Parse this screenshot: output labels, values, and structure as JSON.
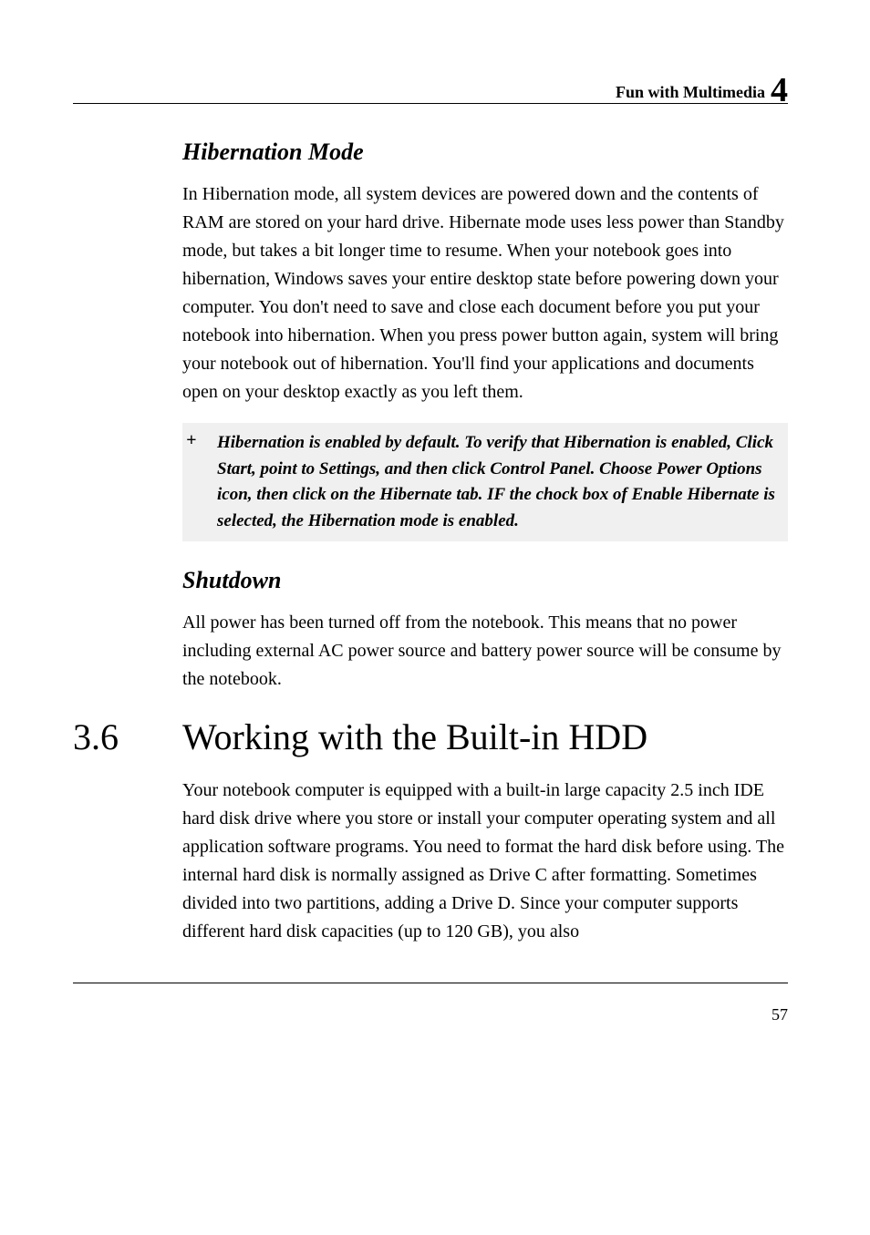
{
  "header": {
    "text": "Fun with Multimedia",
    "chapter_num": "4"
  },
  "sub1": {
    "heading": "Hibernation Mode",
    "para": "In Hibernation mode, all system devices are powered down and the contents of RAM are stored on your hard drive. Hibernate mode uses less power than Standby mode, but takes a bit longer time to resume. When your notebook goes into hibernation, Windows saves your entire desktop state before powering down your computer. You don't need to save and close each document before you put your notebook into hibernation. When you press power button again, system will bring your notebook out of hibernation. You'll find your applications and documents open on your desktop exactly as you left them."
  },
  "note": {
    "marker": "+",
    "t1": "Hibernation is enabled by default. To verify that Hibernation is enabled, Click Start, point to ",
    "b1": "Settings,",
    "t2": " and then click ",
    "b2": "Control Panel.",
    "t3": " Choose ",
    "b3": "Power Options",
    "t4": " icon, then click on the ",
    "b4": "Hibernate tab.",
    "t5": " IF the chock box of Enable Hibernate is selected, the Hibernation mode is enabled."
  },
  "sub2": {
    "heading": "Shutdown",
    "para": "All power has been turned off from the notebook. This means that no power including external AC power source and battery power source will be consume by the notebook."
  },
  "section": {
    "num": "3.6",
    "title": "Working with the Built-in HDD",
    "para": "Your notebook computer is equipped with a built-in large capacity 2.5 inch IDE hard disk drive where you store or install your computer operating system and all application software programs. You need to format the hard disk before using. The internal hard disk is normally assigned as Drive C after formatting. Sometimes divided into two partitions, adding a Drive D. Since your computer supports different hard disk capacities (up to 120 GB), you also"
  },
  "footer": {
    "page_num": "57"
  }
}
